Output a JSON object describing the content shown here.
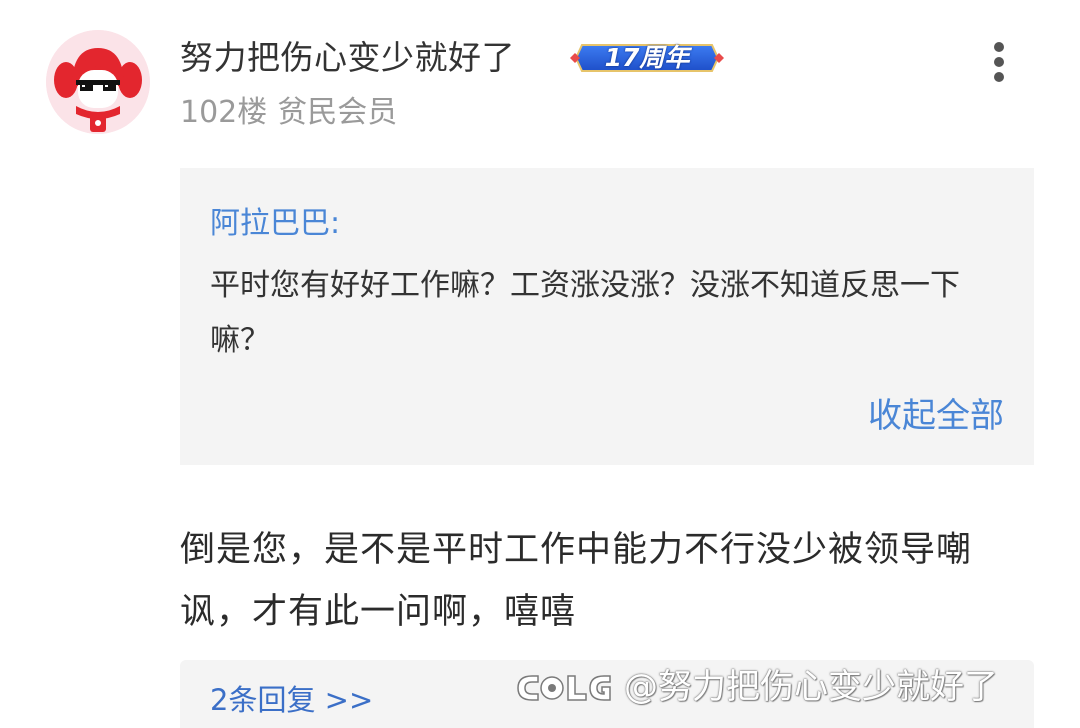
{
  "post": {
    "username": "努力把伤心变少就好了",
    "badge_text": "17周年",
    "floor_label": "102楼",
    "member_level": "贫民会员",
    "avatar_icon": "cartoon-girl-red-hair-sunglasses-avatar",
    "more_icon": "more-vertical-dots-icon"
  },
  "quote": {
    "author": "阿拉巴巴:",
    "text": "平时您有好好工作嘛？工资涨没涨？没涨不知道反思一下嘛？",
    "collapse_label": "收起全部"
  },
  "reply": {
    "text": "倒是您，是不是平时工作中能力不行没少被领导嘲讽，才有此一问啊，嘻嘻"
  },
  "subreplies": {
    "link_label": "2条回复 >>"
  },
  "watermark": {
    "logo_text": "COLG",
    "text": "@努力把伤心变少就好了"
  },
  "colors": {
    "accent_blue": "#4a86d6",
    "quote_background": "#f4f4f4",
    "meta_gray": "#9a9a9a",
    "avatar_background": "#fbe3e8"
  }
}
